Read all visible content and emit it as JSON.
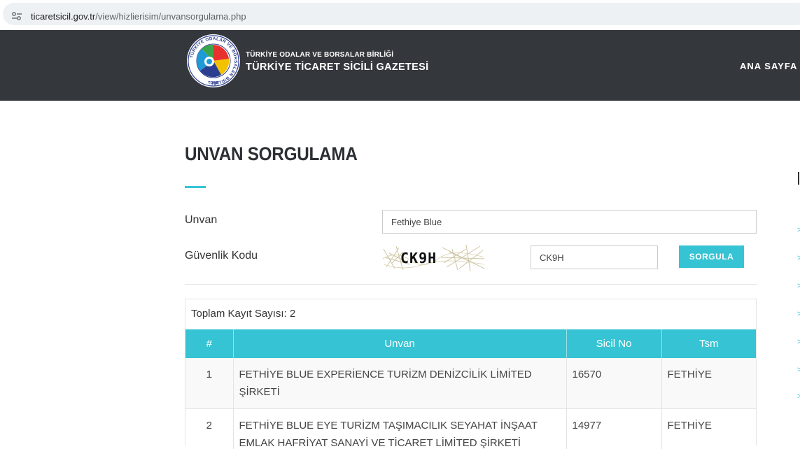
{
  "browser": {
    "url_host": "ticaretsicil.gov.tr",
    "url_path": "/view/hizlierisim/unvansorgulama.php",
    "icon": "site-settings-icon"
  },
  "header": {
    "org_name": "TÜRKİYE ODALAR VE BORSALAR BİRLİĞİ",
    "site_title": "TÜRKİYE TİCARET SİCİLİ GAZETESİ",
    "nav_home": "ANA SAYFA",
    "logo_ring_text": "TÜRKİYE ODALAR VE BORSALAR BİRLİĞİ",
    "logo_bottom_text": "TOBB"
  },
  "page": {
    "title": "UNVAN SORGULAMA"
  },
  "form": {
    "unvan_label": "Unvan",
    "unvan_value": "Fethiye Blue",
    "security_label": "Güvenlik Kodu",
    "captcha_text": "CK9H",
    "security_value": "CK9H",
    "submit_label": "SORGULA"
  },
  "results": {
    "total_text": "Toplam Kayıt Sayısı: 2",
    "columns": [
      "#",
      "Unvan",
      "Sicil No",
      "Tsm"
    ],
    "rows": [
      {
        "no": "1",
        "unvan": "FETHİYE BLUE EXPERİENCE TURİZM DENİZCİLİK LİMİTED ŞİRKETİ",
        "sicil_no": "16570",
        "tsm": "FETHİYE"
      },
      {
        "no": "2",
        "unvan": "FETHİYE BLUE EYE TURİZM TAŞIMACILIK SEYAHAT İNŞAAT EMLAK HAFRİYAT SANAYİ VE TİCARET LİMİTED ŞİRKETİ",
        "sicil_no": "14977",
        "tsm": "FETHİYE"
      }
    ]
  },
  "colors": {
    "accent": "#36c3d3",
    "header_bg": "#34373c",
    "text": "#333333"
  },
  "sidebar_edge": {
    "chevrons": [
      ">",
      ">",
      ">",
      ">",
      ">",
      ">",
      ">"
    ]
  }
}
